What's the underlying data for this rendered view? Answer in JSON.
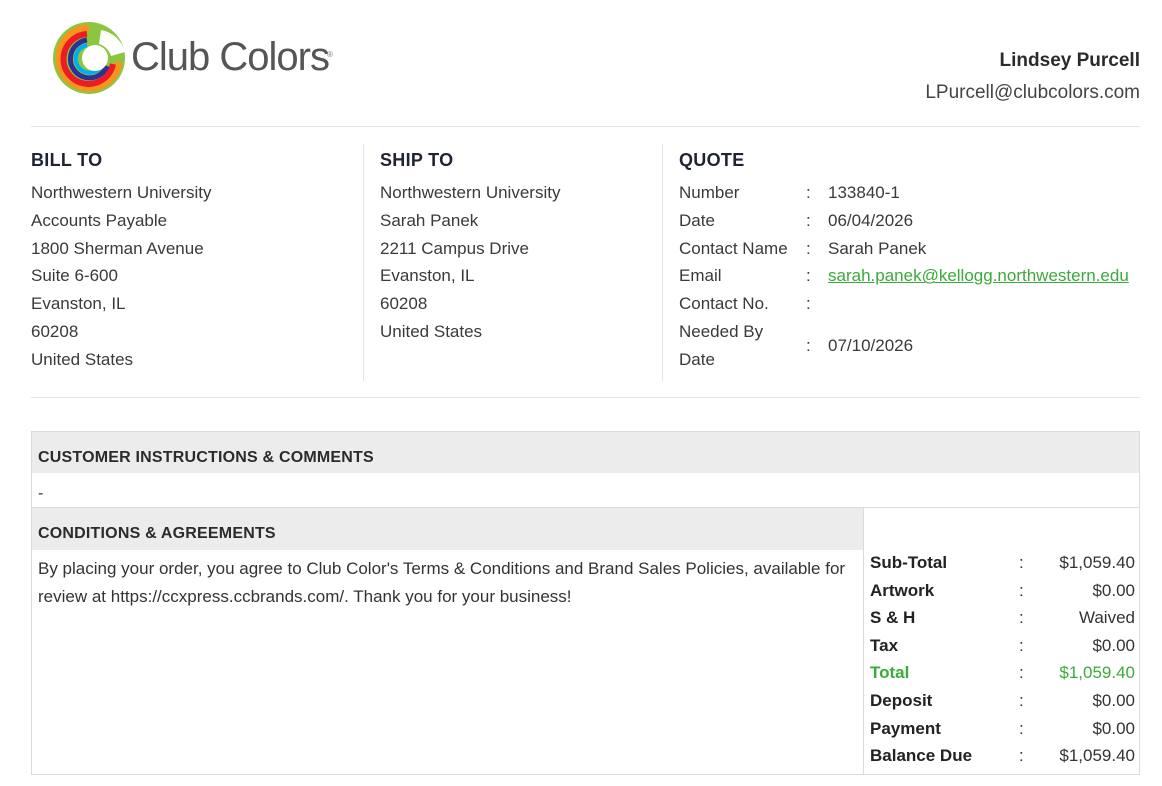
{
  "brand": {
    "name": "Club Colors",
    "reg": "®",
    "accent": "#3aaa3a"
  },
  "rep": {
    "name": "Lindsey Purcell",
    "email": "LPurcell@clubcolors.com"
  },
  "bill_to": {
    "title": "BILL TO",
    "lines": [
      "Northwestern University",
      "Accounts Payable",
      "1800 Sherman Avenue",
      "Suite 6-600",
      "Evanston, IL",
      "60208",
      "United States"
    ]
  },
  "ship_to": {
    "title": "SHIP TO",
    "lines": [
      "Northwestern University",
      "Sarah Panek",
      "2211 Campus Drive",
      "Evanston, IL",
      "60208",
      "United States"
    ]
  },
  "quote": {
    "title": "QUOTE",
    "rows": [
      {
        "label": "Number",
        "value": "133840-1"
      },
      {
        "label": "Date",
        "value": "06/04/2026"
      },
      {
        "label": "Contact Name",
        "value": "Sarah Panek"
      },
      {
        "label": "Email",
        "value": "sarah.panek@kellogg.northwestern.edu"
      },
      {
        "label": "Contact No.",
        "value": ""
      },
      {
        "label": "Needed By",
        "label2": "Date",
        "value": "07/10/2026"
      }
    ],
    "colon": ":"
  },
  "customer_instructions": {
    "title": "CUSTOMER INSTRUCTIONS & COMMENTS",
    "text": "-"
  },
  "conditions": {
    "title": "CONDITIONS & AGREEMENTS",
    "text": "By placing your order, you agree to Club Color's Terms & Conditions and Brand Sales Policies, available for review at https://ccxpress.ccbrands.com/. Thank you for your business!"
  },
  "totals": [
    {
      "label": "Sub-Total",
      "value": "$1,059.40"
    },
    {
      "label": "Artwork",
      "value": "$0.00"
    },
    {
      "label": "S & H",
      "value": "Waived"
    },
    {
      "label": "Tax",
      "value": "$0.00"
    },
    {
      "label": "Total",
      "value": "$1,059.40"
    },
    {
      "label": "Deposit",
      "value": "$0.00"
    },
    {
      "label": "Payment",
      "value": "$0.00"
    },
    {
      "label": "Balance Due",
      "value": "$1,059.40"
    }
  ]
}
